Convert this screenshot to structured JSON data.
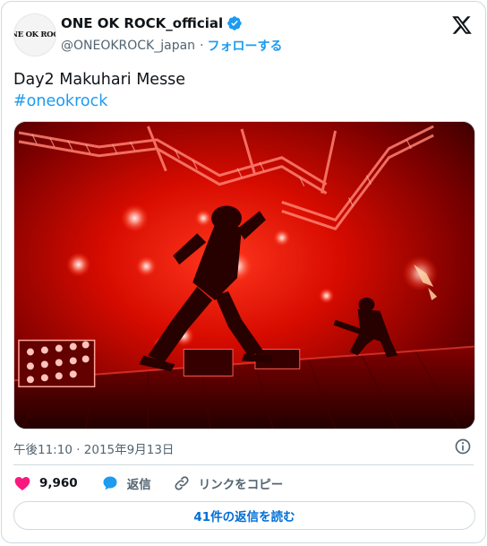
{
  "account": {
    "avatar_text": "ONE OK ROCK",
    "display_name": "ONE OK ROCK_official",
    "handle": "@ONEOKROCK_japan",
    "separator": "·",
    "follow_label": "フォローする",
    "verified": true,
    "verified_color": "#1d9bf0"
  },
  "tweet": {
    "text": "Day2 Makuhari Messe",
    "hashtag": "#oneokrock",
    "timestamp": "午後11:10 · 2015年9月13日"
  },
  "media": {
    "description_icon": "concert-photo",
    "dominant_color": "#d00000"
  },
  "actions": {
    "like_count": "9,960",
    "reply_label": "返信",
    "copy_link_label": "リンクをコピー"
  },
  "replies_button_label": "41件の返信を読む",
  "colors": {
    "accent": "#1d9bf0",
    "like": "#f91880",
    "link": "#006fd6",
    "muted": "#536471",
    "border": "#cfd9de"
  }
}
